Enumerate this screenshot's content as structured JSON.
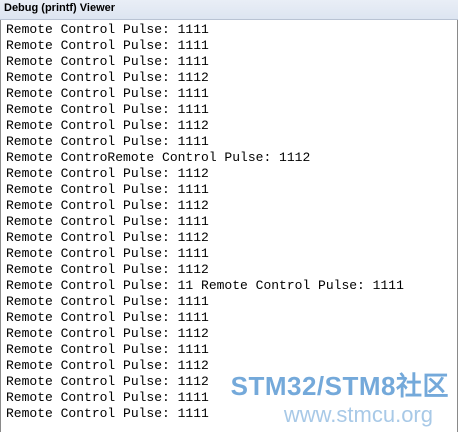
{
  "window": {
    "title": "Debug (printf) Viewer"
  },
  "log_lines": [
    "Remote Control Pulse: 1111",
    "Remote Control Pulse: 1111",
    "Remote Control Pulse: 1111",
    "Remote Control Pulse: 1112",
    "Remote Control Pulse: 1111",
    "Remote Control Pulse: 1111",
    "Remote Control Pulse: 1112",
    "Remote Control Pulse: 1111",
    "Remote ControRemote Control Pulse: 1112",
    "Remote Control Pulse: 1112",
    "Remote Control Pulse: 1111",
    "Remote Control Pulse: 1112",
    "Remote Control Pulse: 1111",
    "Remote Control Pulse: 1112",
    "Remote Control Pulse: 1111",
    "Remote Control Pulse: 1112",
    "Remote Control Pulse: 11 Remote Control Pulse: 1111",
    "Remote Control Pulse: 1111",
    "Remote Control Pulse: 1111",
    "Remote Control Pulse: 1112",
    "Remote Control Pulse: 1111",
    "Remote Control Pulse: 1112",
    "Remote Control Pulse: 1112",
    "Remote Control Pulse: 1111",
    "Remote Control Pulse: 1111"
  ],
  "watermark": {
    "brand": "STM32/STM8社区",
    "url": "www.stmcu.org"
  },
  "colors": {
    "titlebar": "#dde5f1",
    "text": "#000000",
    "watermark": "#468ccd"
  }
}
